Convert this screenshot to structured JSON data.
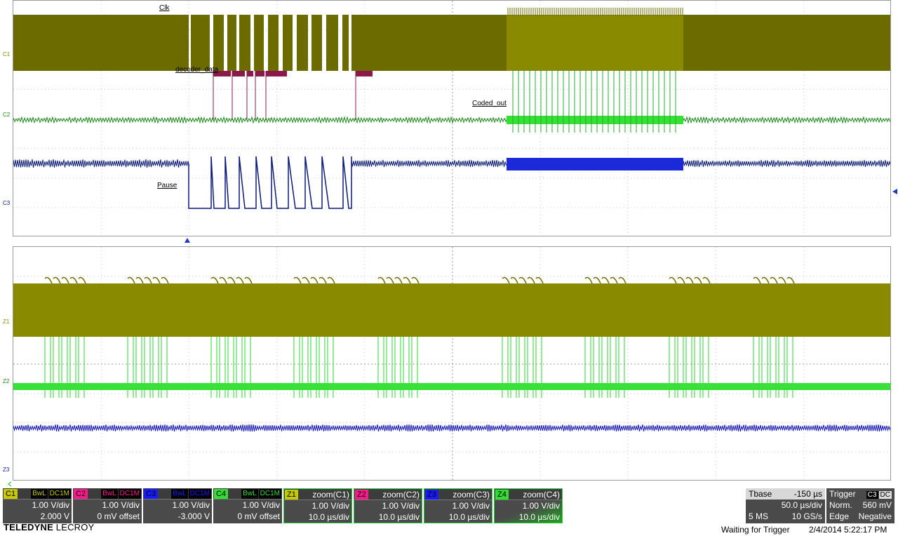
{
  "top_grid": {
    "channel_markers": [
      "C1",
      "C2",
      "C3"
    ],
    "trace_labels": {
      "clk": "Clk",
      "decoder": "decoder_data",
      "coded": "Coded_out",
      "pause": "Pause"
    }
  },
  "bottom_grid": {
    "channel_markers": [
      "Z1",
      "Z2",
      "Z3"
    ]
  },
  "colors": {
    "c1": "#6b6b00",
    "c1_fill": "#8a8a00",
    "c2": "#8b1a4a",
    "c3": "#0a1a7a",
    "c4": "#1e8a1e",
    "z1": "#8a8a00",
    "z2": "#2ad82a",
    "z3": "#1515c8",
    "grid": "#c8c8c8",
    "panel": "#4a4a4a"
  },
  "channels": [
    {
      "tag": "C1",
      "bwl": "BwL",
      "coupling": "DC1M",
      "scale": "1.00 V/div",
      "offset": "2.000 V",
      "color": "#c8c800"
    },
    {
      "tag": "C2",
      "bwl": "BwL",
      "coupling": "DC1M",
      "scale": "1.00 V/div",
      "offset": "0 mV offset",
      "color": "#ff1a8c"
    },
    {
      "tag": "C3",
      "bwl": "BwL",
      "coupling": "DC1M",
      "scale": "1.00 V/div",
      "offset": "-3.000 V",
      "color": "#1a1aff"
    },
    {
      "tag": "C4",
      "bwl": "BwL",
      "coupling": "DC1M",
      "scale": "1.00 V/div",
      "offset": "0 mV offset",
      "color": "#33dd33"
    }
  ],
  "zooms": [
    {
      "tag": "Z1",
      "name": "zoom(C1)",
      "scale": "1.00 V/div",
      "time": "10.0 µs/div",
      "color": "#c8c800"
    },
    {
      "tag": "Z2",
      "name": "zoom(C2)",
      "scale": "1.00 V/div",
      "time": "10.0 µs/div",
      "color": "#ff1a8c"
    },
    {
      "tag": "Z3",
      "name": "zoom(C3)",
      "scale": "1.00 V/div",
      "time": "10.0 µs/div",
      "color": "#1a1aff"
    },
    {
      "tag": "Z4",
      "name": "zoom(C4)",
      "scale": "1.00 V/div",
      "time": "10.0 µs/div",
      "color": "#33dd33"
    }
  ],
  "timebase": {
    "label": "Tbase",
    "delay": "-150 µs",
    "per_div": "50.0 µs/div",
    "samples": "5 MS",
    "rate": "10 GS/s"
  },
  "trigger": {
    "label": "Trigger",
    "source": "C3",
    "coupling": "DC",
    "mode": "Norm.",
    "level": "560 mV",
    "type": "Edge",
    "slope": "Negative"
  },
  "brand": {
    "name": "TELEDYNE",
    "sub": "LECROY"
  },
  "status": {
    "message": "Waiting for Trigger",
    "datetime": "2/4/2014 5:22:17 PM"
  }
}
